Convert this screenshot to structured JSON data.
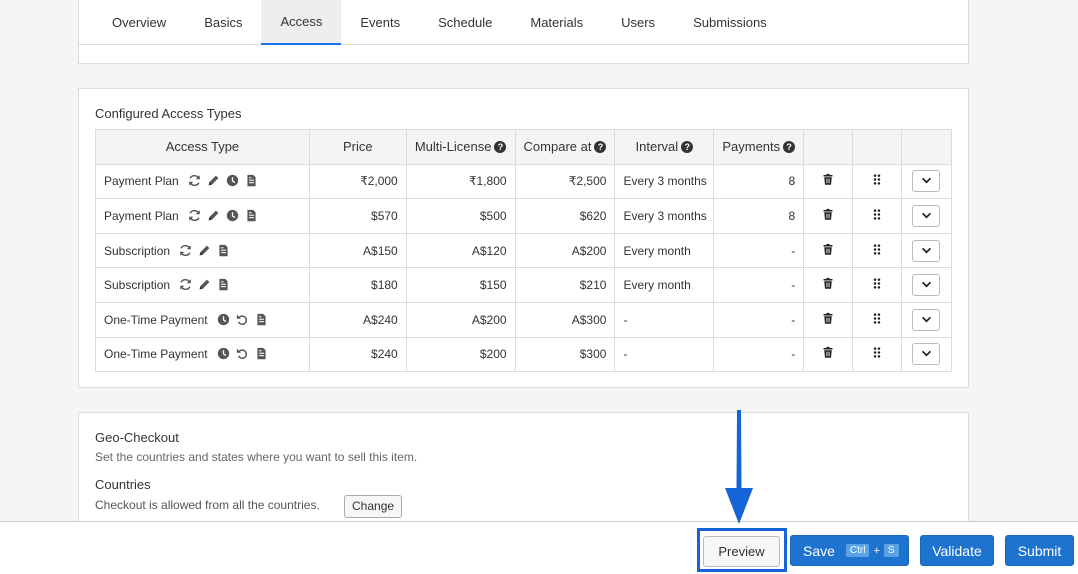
{
  "tabs": [
    {
      "label": "Overview"
    },
    {
      "label": "Basics"
    },
    {
      "label": "Access"
    },
    {
      "label": "Events"
    },
    {
      "label": "Schedule"
    },
    {
      "label": "Materials"
    },
    {
      "label": "Users"
    },
    {
      "label": "Submissions"
    }
  ],
  "active_tab": "Access",
  "access": {
    "title": "Configured Access Types",
    "columns": {
      "access_type": "Access Type",
      "price": "Price",
      "multi_license": "Multi-License",
      "compare_at": "Compare at",
      "interval": "Interval",
      "payments": "Payments"
    },
    "help_glyph": "?",
    "rows": [
      {
        "name": "Payment Plan",
        "icons": [
          "refresh-icon",
          "pencil-icon",
          "clock-icon",
          "document-icon"
        ],
        "price": "₹2,000",
        "multi": "₹1,800",
        "compare": "₹2,500",
        "interval": "Every 3 months",
        "payments": "8"
      },
      {
        "name": "Payment Plan",
        "icons": [
          "refresh-icon",
          "pencil-icon",
          "clock-icon",
          "document-icon"
        ],
        "price": "$570",
        "multi": "$500",
        "compare": "$620",
        "interval": "Every 3 months",
        "payments": "8"
      },
      {
        "name": "Subscription",
        "icons": [
          "refresh-icon",
          "pencil-icon",
          "document-icon"
        ],
        "price": "A$150",
        "multi": "A$120",
        "compare": "A$200",
        "interval": "Every month",
        "payments": "-"
      },
      {
        "name": "Subscription",
        "icons": [
          "refresh-icon",
          "pencil-icon",
          "document-icon"
        ],
        "price": "$180",
        "multi": "$150",
        "compare": "$210",
        "interval": "Every month",
        "payments": "-"
      },
      {
        "name": "One-Time Payment",
        "icons": [
          "clock-icon",
          "undo-icon",
          "document-icon"
        ],
        "price": "A$240",
        "multi": "A$200",
        "compare": "A$300",
        "interval": "-",
        "payments": "-"
      },
      {
        "name": "One-Time Payment",
        "icons": [
          "clock-icon",
          "undo-icon",
          "document-icon"
        ],
        "price": "$240",
        "multi": "$200",
        "compare": "$300",
        "interval": "-",
        "payments": "-"
      }
    ],
    "row_action_icons": [
      "trash-icon",
      "drag-handle-icon",
      "chevron-down-icon"
    ]
  },
  "geo": {
    "title": "Geo-Checkout",
    "subtitle": "Set the countries and states where you want to sell this item.",
    "countries_title": "Countries",
    "countries_text": "Checkout is allowed from all the countries.",
    "change_label": "Change"
  },
  "footer": {
    "preview_label": "Preview",
    "save_label": "Save",
    "save_kbd_ctrl": "Ctrl",
    "save_kbd_plus": "+",
    "save_kbd_key": "S",
    "validate_label": "Validate",
    "submit_label": "Submit"
  },
  "colors": {
    "primary": "#1e73cf",
    "highlight": "#1565d8",
    "active_tab_underline": "#1a73e8"
  }
}
